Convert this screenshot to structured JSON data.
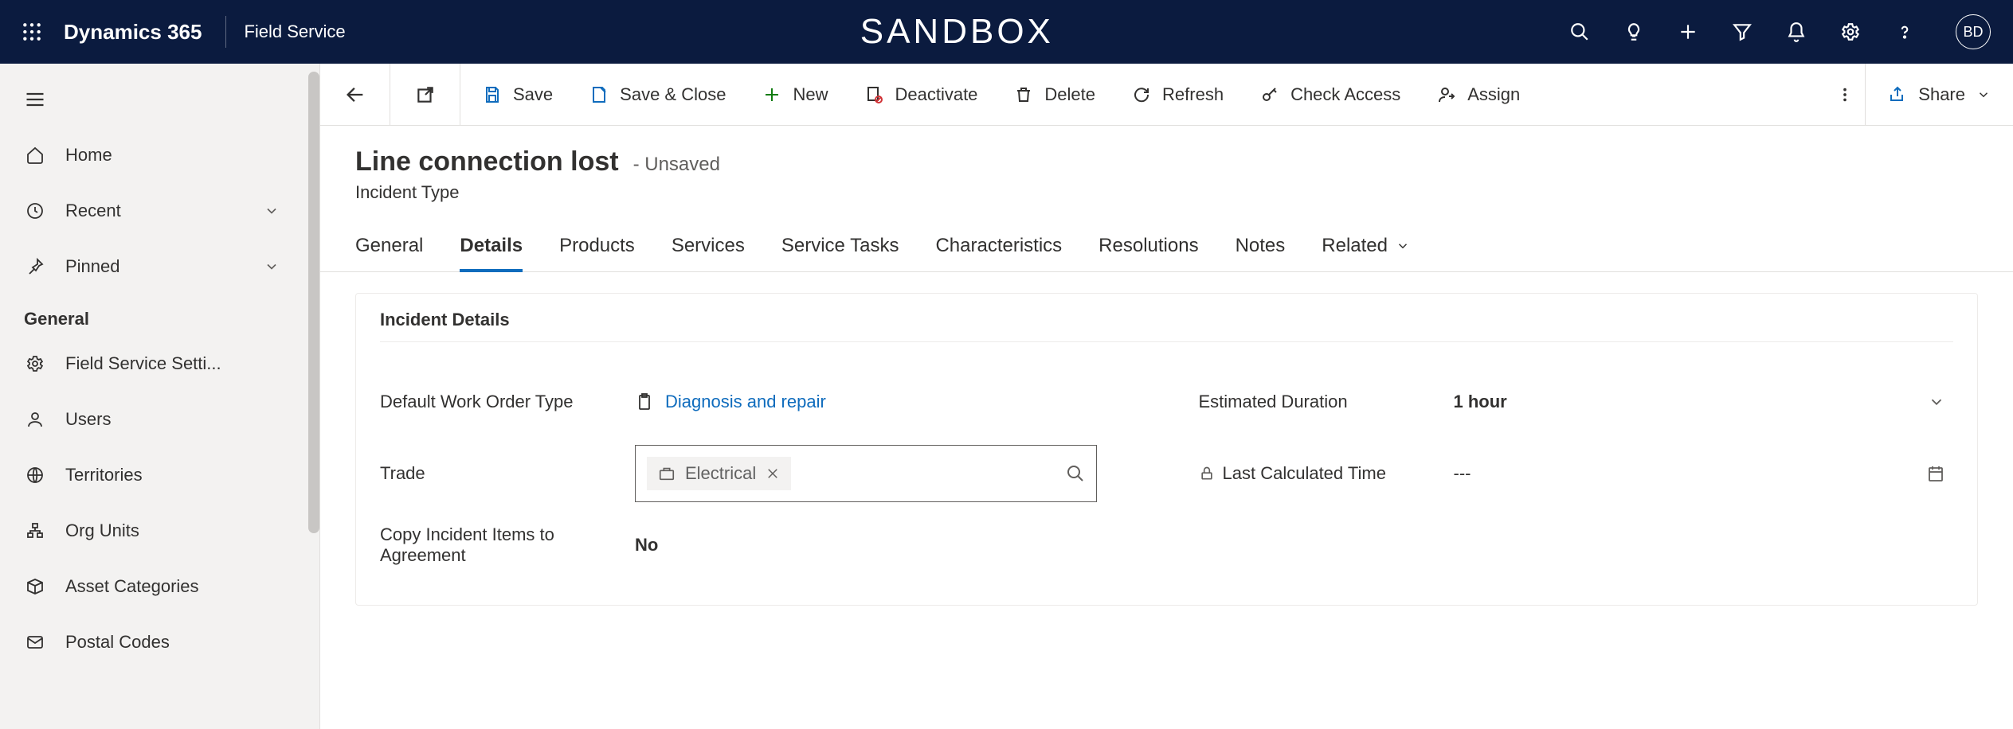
{
  "topbar": {
    "brand": "Dynamics 365",
    "app": "Field Service",
    "env": "SANDBOX",
    "avatar": "BD"
  },
  "sidebar": {
    "home": "Home",
    "recent": "Recent",
    "pinned": "Pinned",
    "group": "General",
    "items": [
      "Field Service Setti...",
      "Users",
      "Territories",
      "Org Units",
      "Asset Categories",
      "Postal Codes"
    ]
  },
  "commands": {
    "save": "Save",
    "save_close": "Save & Close",
    "new": "New",
    "deactivate": "Deactivate",
    "delete": "Delete",
    "refresh": "Refresh",
    "check_access": "Check Access",
    "assign": "Assign",
    "share": "Share"
  },
  "record": {
    "title": "Line connection lost",
    "status": "- Unsaved",
    "entity": "Incident Type"
  },
  "tabs": [
    "General",
    "Details",
    "Products",
    "Services",
    "Service Tasks",
    "Characteristics",
    "Resolutions",
    "Notes",
    "Related"
  ],
  "section_title": "Incident Details",
  "fields": {
    "default_wo_type": {
      "label": "Default Work Order Type",
      "value": "Diagnosis and repair"
    },
    "trade": {
      "label": "Trade",
      "value": "Electrical"
    },
    "copy_items": {
      "label": "Copy Incident Items to Agreement",
      "value": "No"
    },
    "est_duration": {
      "label": "Estimated Duration",
      "value": "1 hour"
    },
    "last_calc": {
      "label": "Last Calculated Time",
      "value": "---"
    }
  }
}
